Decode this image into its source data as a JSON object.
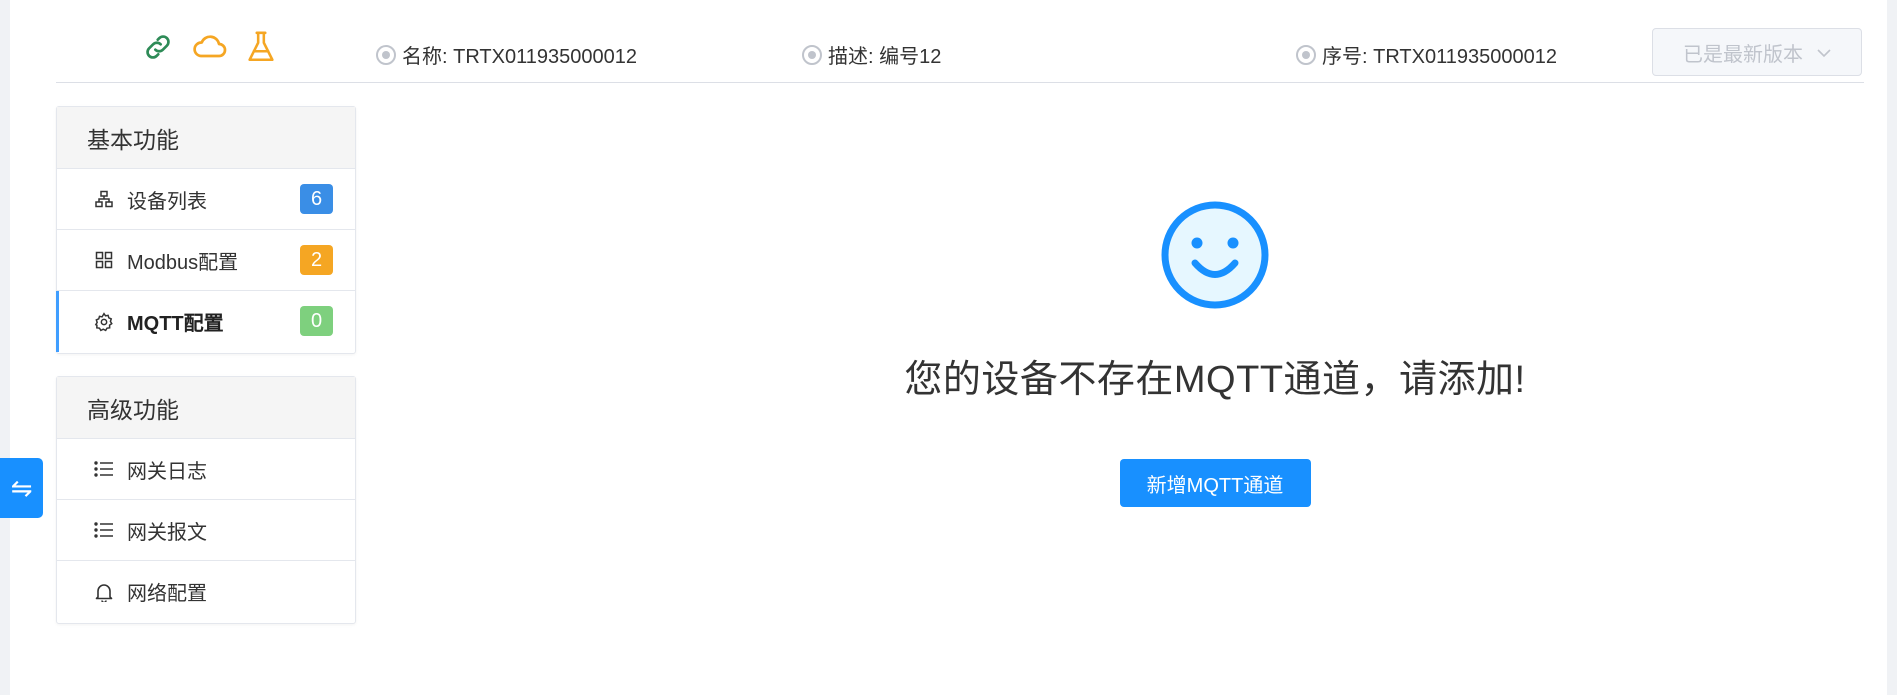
{
  "header": {
    "status_icons": [
      "link-icon",
      "cloud-icon",
      "flask-icon"
    ],
    "name_label": "名称: TRTX011935000012",
    "desc_label": "描述: 编号12",
    "serial_label": "序号: TRTX011935000012",
    "version_button": "已是最新版本"
  },
  "sidebar": {
    "basic": {
      "title": "基本功能",
      "items": [
        {
          "label": "设备列表",
          "icon": "sitemap-icon",
          "badge": "6",
          "badge_color": "#3a8ee6"
        },
        {
          "label": "Modbus配置",
          "icon": "grid-icon",
          "badge": "2",
          "badge_color": "#f5a623"
        },
        {
          "label": "MQTT配置",
          "icon": "gear-icon",
          "badge": "0",
          "badge_color": "#7ed07e",
          "active": true
        }
      ]
    },
    "advanced": {
      "title": "高级功能",
      "items": [
        {
          "label": "网关日志",
          "icon": "list-icon"
        },
        {
          "label": "网关报文",
          "icon": "list-icon"
        },
        {
          "label": "网络配置",
          "icon": "bell-icon"
        }
      ]
    }
  },
  "side_toggle": "⇋",
  "empty_state": {
    "icon": "smile-icon",
    "message": "您的设备不存在MQTT通道，请添加!",
    "button": "新增MQTT通道"
  },
  "colors": {
    "primary": "#1890ff",
    "link_green": "#2e8b57",
    "cloud_orange": "#f5a623"
  }
}
